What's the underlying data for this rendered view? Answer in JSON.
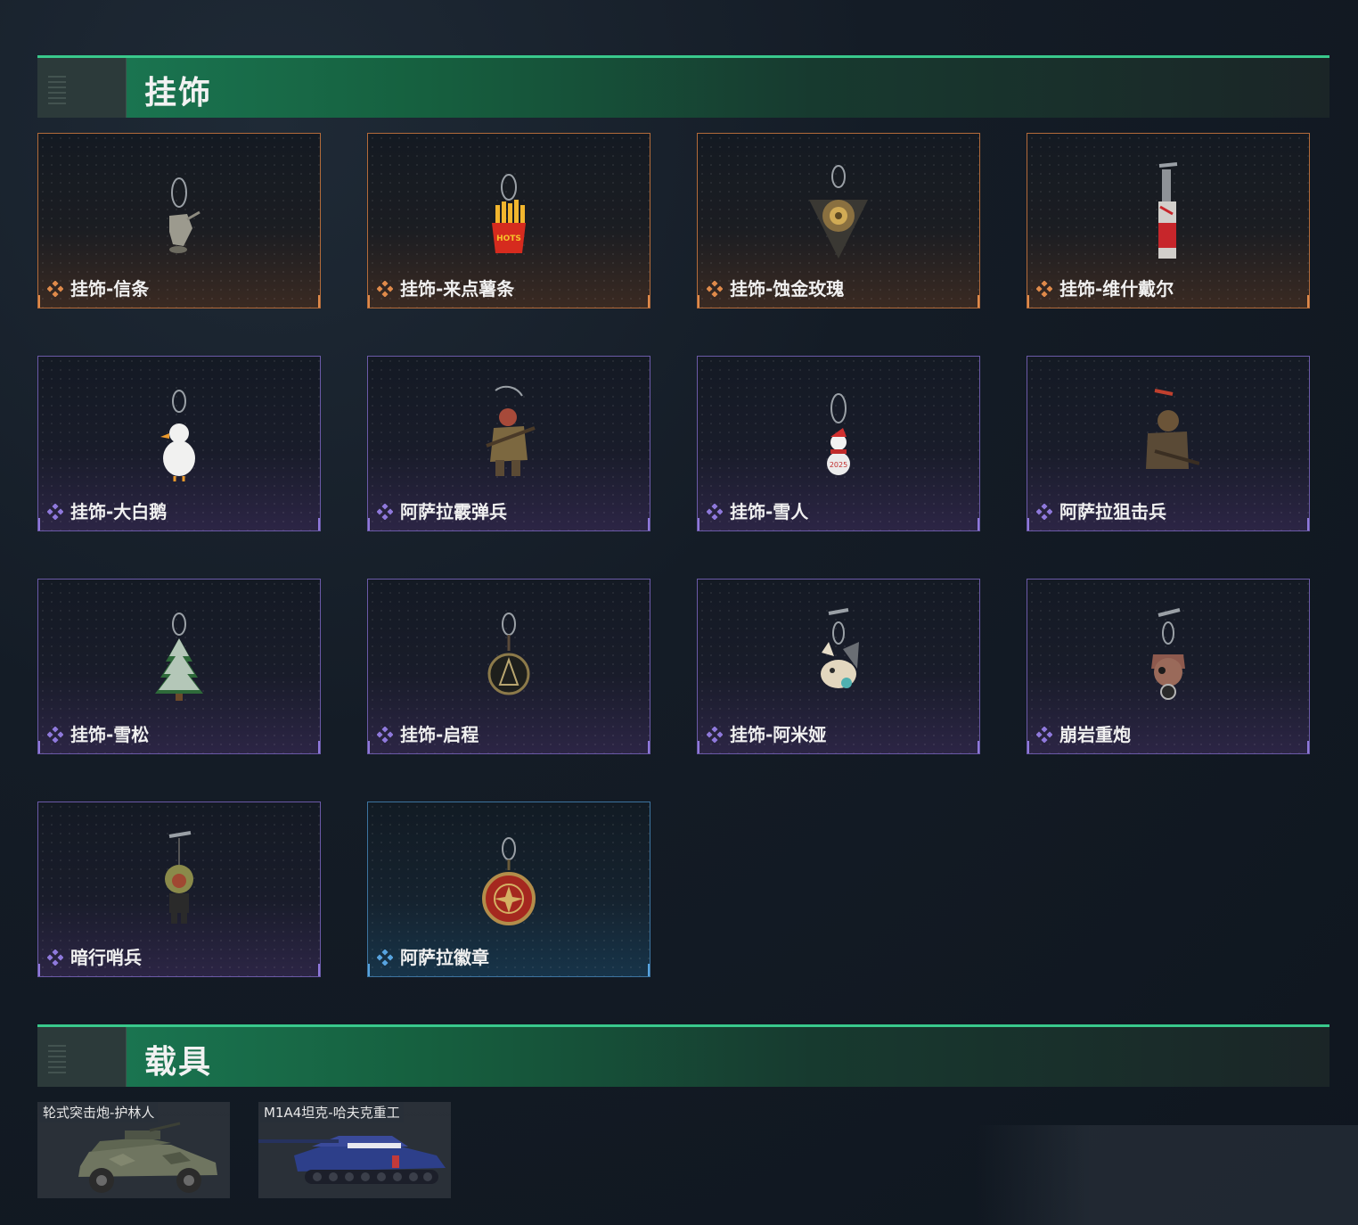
{
  "sections": {
    "charms": {
      "title": "挂饰"
    },
    "vehicles": {
      "title": "载具"
    }
  },
  "charms": [
    {
      "name": "挂饰-信条",
      "rarity": "orange",
      "icon": "kettle-charm-icon"
    },
    {
      "name": "挂饰-来点薯条",
      "rarity": "orange",
      "icon": "fries-charm-icon"
    },
    {
      "name": "挂饰-蚀金玫瑰",
      "rarity": "orange",
      "icon": "rose-charm-icon"
    },
    {
      "name": "挂饰-维什戴尔",
      "rarity": "orange",
      "icon": "tag-charm-icon"
    },
    {
      "name": "挂饰-大白鹅",
      "rarity": "purple",
      "icon": "goose-charm-icon"
    },
    {
      "name": "阿萨拉霰弹兵",
      "rarity": "purple",
      "icon": "shotgunner-charm-icon"
    },
    {
      "name": "挂饰-雪人",
      "rarity": "purple",
      "icon": "snowman-charm-icon"
    },
    {
      "name": "阿萨拉狙击兵",
      "rarity": "purple",
      "icon": "sniper-charm-icon"
    },
    {
      "name": "挂饰-雪松",
      "rarity": "purple",
      "icon": "pine-tree-charm-icon"
    },
    {
      "name": "挂饰-启程",
      "rarity": "purple",
      "icon": "medal-charm-icon"
    },
    {
      "name": "挂饰-阿米娅",
      "rarity": "purple",
      "icon": "bunny-charm-icon"
    },
    {
      "name": "崩岩重炮",
      "rarity": "purple",
      "icon": "gunner-charm-icon"
    },
    {
      "name": "暗行哨兵",
      "rarity": "purple",
      "icon": "sentry-charm-icon"
    },
    {
      "name": "阿萨拉徽章",
      "rarity": "blue",
      "icon": "badge-charm-icon"
    }
  ],
  "vehicles": [
    {
      "name": "轮式突击炮-护林人",
      "icon": "armored-car-icon"
    },
    {
      "name": "M1A4坦克-哈夫克重工",
      "icon": "tank-icon"
    }
  ],
  "colors": {
    "orange": "#e08a4a",
    "purple": "#8f79dc",
    "blue": "#58a4e0",
    "header_green": "#1b7a55"
  }
}
